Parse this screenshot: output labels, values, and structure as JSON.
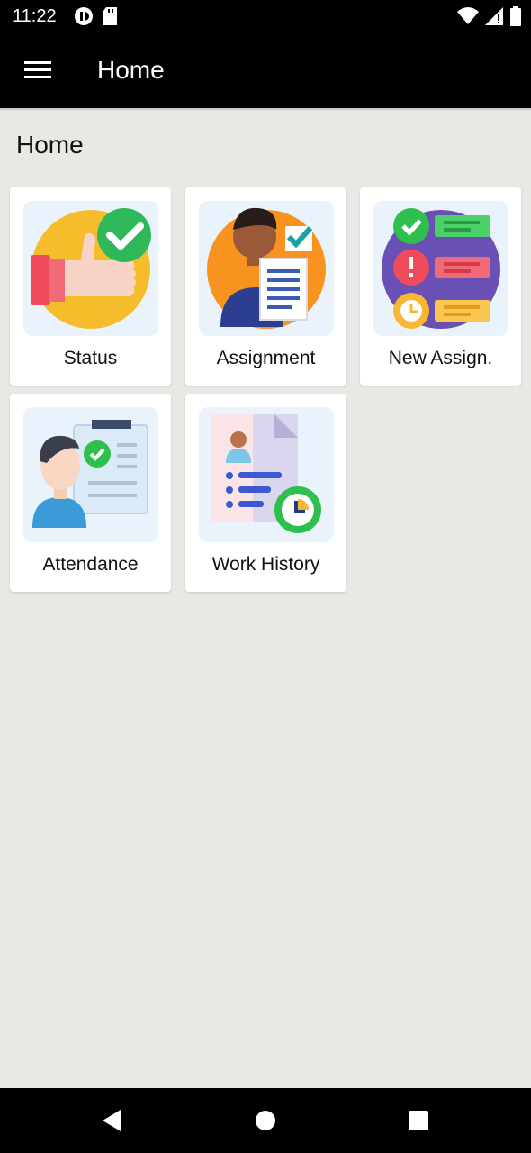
{
  "status_bar": {
    "time": "11:22",
    "icons": [
      "data-saver-icon",
      "sd-card-icon",
      "wifi-icon",
      "signal-icon",
      "battery-icon"
    ]
  },
  "app_bar": {
    "title": "Home",
    "menu_icon": "hamburger-menu-icon"
  },
  "page": {
    "heading": "Home"
  },
  "tiles": [
    {
      "label": "Status",
      "icon": "thumbs-up-check-icon"
    },
    {
      "label": "Assignment",
      "icon": "person-document-icon"
    },
    {
      "label": "New Assign.",
      "icon": "checklist-status-icon"
    },
    {
      "label": "Attendance",
      "icon": "attendance-person-icon"
    },
    {
      "label": "Work History",
      "icon": "work-history-document-icon"
    }
  ],
  "nav_bar": {
    "icons": [
      "back-icon",
      "home-icon",
      "recents-icon"
    ]
  },
  "colors": {
    "background": "#e7e9e4",
    "app_bar": "#000000",
    "tile": "#ffffff",
    "tile_art_bg": "#eaf3fb"
  }
}
